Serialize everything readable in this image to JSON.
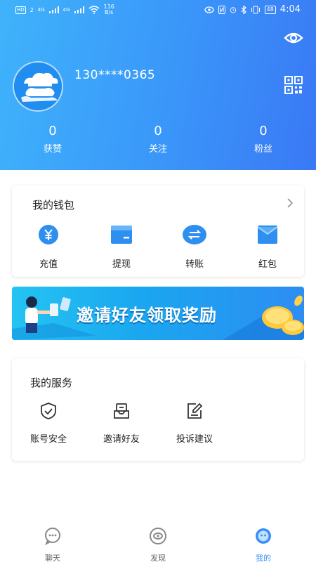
{
  "status_bar": {
    "network_badge": "HD",
    "network_badge_sub": "2",
    "signal1_label": "4G",
    "signal2_label": "4G",
    "speed_value": "116",
    "speed_unit": "B/s",
    "battery": "48",
    "time": "4:04"
  },
  "profile": {
    "phone": "130****0365",
    "stats": [
      {
        "value": "0",
        "label": "获赞"
      },
      {
        "value": "0",
        "label": "关注"
      },
      {
        "value": "0",
        "label": "粉丝"
      }
    ]
  },
  "wallet": {
    "title": "我的钱包",
    "items": [
      {
        "label": "充值",
        "icon": "yuan-coin-icon"
      },
      {
        "label": "提现",
        "icon": "wallet-card-icon"
      },
      {
        "label": "转账",
        "icon": "transfer-icon"
      },
      {
        "label": "红包",
        "icon": "red-envelope-icon"
      }
    ]
  },
  "banner": {
    "text": "邀请好友领取奖励"
  },
  "services": {
    "title": "我的服务",
    "items": [
      {
        "label": "账号安全",
        "icon": "shield-check-icon"
      },
      {
        "label": "邀请好友",
        "icon": "invite-envelope-icon"
      },
      {
        "label": "投诉建议",
        "icon": "edit-note-icon"
      }
    ]
  },
  "tabbar": {
    "items": [
      {
        "label": "聊天",
        "icon": "chat-bubble-icon"
      },
      {
        "label": "发现",
        "icon": "eye-discover-icon"
      },
      {
        "label": "我的",
        "icon": "profile-face-icon"
      }
    ],
    "active_color": "#3a8ef6"
  },
  "colors": {
    "header_gradient_start": "#3fb3fb",
    "header_gradient_end": "#3a78f5",
    "accent": "#3a8ef6"
  }
}
